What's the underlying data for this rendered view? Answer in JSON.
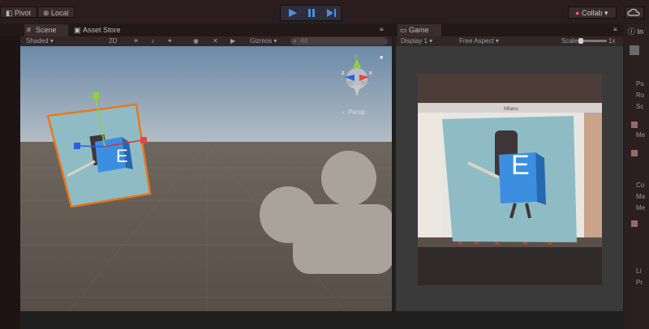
{
  "toolbar": {
    "pivot": "Pivot",
    "local": "Local",
    "collab": "Collab",
    "colors": {
      "bar": "#2b1d1d",
      "play": "#4a8fe0"
    }
  },
  "tabs": {
    "scene": "Scene",
    "asset_store": "Asset Store",
    "game": "Game",
    "inspector": "In"
  },
  "scene_bar": {
    "shading": "Shaded",
    "mode": "2D",
    "gizmos": "Gizmos",
    "search_placeholder": "All"
  },
  "game_bar": {
    "display": "Display 1",
    "aspect": "Free Aspect",
    "scale_label": "Scale",
    "scale_value": "1x"
  },
  "scene_view": {
    "gizmo_x": "x",
    "gizmo_y": "y",
    "gizmo_z": "z",
    "projection": "Persp",
    "logo_letter": "E"
  },
  "game_view": {
    "photo_title": "Milano",
    "logo_letter": "E"
  },
  "inspector_rows": [
    "Po",
    "Ro",
    "Sc",
    "Me",
    "Co",
    "Ma",
    "Me",
    "Li",
    "Pr"
  ]
}
